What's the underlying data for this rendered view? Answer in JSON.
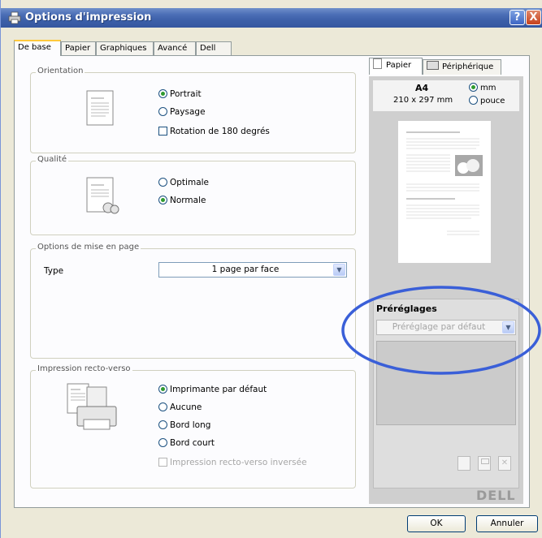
{
  "window": {
    "title": "Options d'impression",
    "help_btn": "?",
    "close_btn": "X"
  },
  "tabs": [
    "De base",
    "Papier",
    "Graphiques",
    "Avancé",
    "Dell"
  ],
  "orientation": {
    "title": "Orientation",
    "options": [
      "Portrait",
      "Paysage"
    ],
    "selected": "Portrait",
    "rotate_label": "Rotation de 180 degrés"
  },
  "quality": {
    "title": "Qualité",
    "options": [
      "Optimale",
      "Normale"
    ],
    "selected": "Normale"
  },
  "layout": {
    "title": "Options de mise en page",
    "type_label": "Type",
    "type_value": "1 page par face"
  },
  "duplex": {
    "title": "Impression recto-verso",
    "options": [
      "Imprimante par défaut",
      "Aucune",
      "Bord long",
      "Bord court"
    ],
    "selected": "Imprimante par défaut",
    "reverse_label": "Impression recto-verso inversée"
  },
  "preview": {
    "tab_paper": "Papier",
    "tab_device": "Périphérique",
    "paper_size": "A4",
    "dimensions": "210 x 297 mm",
    "unit_mm": "mm",
    "unit_inch": "pouce",
    "unit_selected": "mm"
  },
  "presets": {
    "title": "Préréglages",
    "value": "Préréglage par défaut"
  },
  "brand": {
    "logo_text": "DELL",
    "annotation_color": "#3a5fd8"
  },
  "buttons": {
    "ok": "OK",
    "cancel": "Annuler"
  }
}
